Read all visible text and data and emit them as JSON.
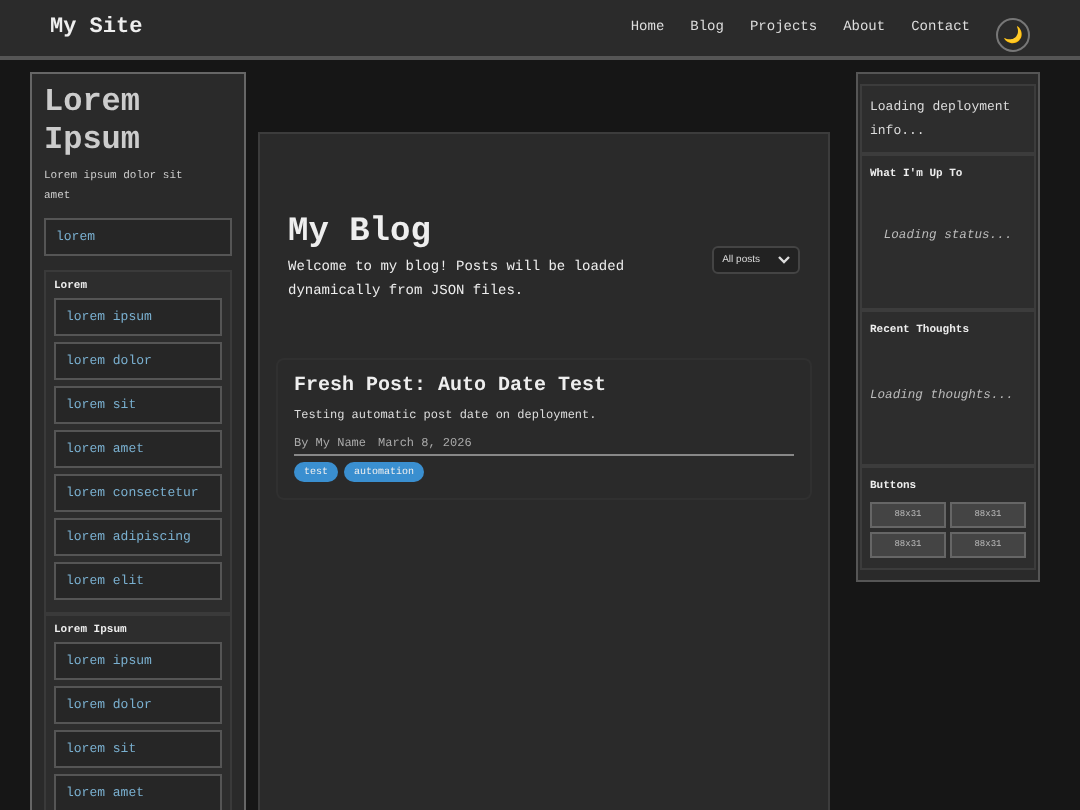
{
  "header": {
    "site_title": "My Site",
    "nav": [
      {
        "label": "Home"
      },
      {
        "label": "Blog"
      },
      {
        "label": "Projects"
      },
      {
        "label": "About"
      },
      {
        "label": "Contact"
      }
    ],
    "theme_toggle": "🌙"
  },
  "left_sidebar": {
    "title": "Lorem Ipsum",
    "description": "Lorem ipsum dolor sit amet",
    "top_link": "lorem",
    "sections": [
      {
        "heading": "Lorem",
        "links": [
          "lorem ipsum",
          "lorem dolor",
          "lorem sit",
          "lorem amet",
          "lorem consectetur",
          "lorem adipiscing",
          "lorem elit"
        ]
      },
      {
        "heading": "Lorem Ipsum",
        "links": [
          "lorem ipsum",
          "lorem dolor",
          "lorem sit",
          "lorem amet"
        ]
      }
    ]
  },
  "main": {
    "title": "My Blog",
    "intro": "Welcome to my blog! Posts will be loaded dynamically from JSON files.",
    "filter": {
      "value": "All posts"
    },
    "posts": [
      {
        "title": "Fresh Post: Auto Date Test",
        "summary": "Testing automatic post date on deployment.",
        "author": "By My Name",
        "date": "March 8, 2026",
        "tags": [
          "test",
          "automation"
        ]
      }
    ]
  },
  "right_sidebar": {
    "deployment": "Loading deployment info...",
    "status": {
      "heading": "What I'm Up To",
      "text": "Loading status..."
    },
    "thoughts": {
      "heading": "Recent Thoughts",
      "text": "Loading thoughts..."
    },
    "buttons": {
      "heading": "Buttons",
      "items": [
        "88x31",
        "88x31",
        "88x31",
        "88x31"
      ]
    }
  }
}
